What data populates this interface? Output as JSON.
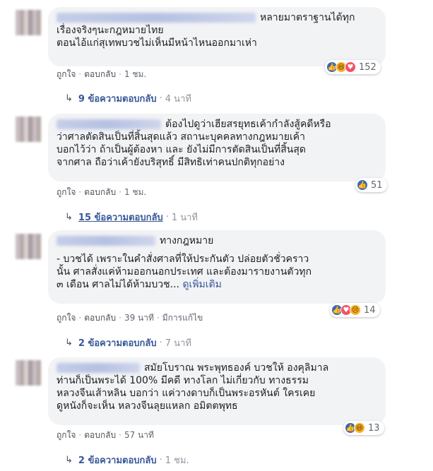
{
  "comments": [
    {
      "lines": [
        "หลายมาตราฐานได้ทุก",
        "เรื่องจริงๆนะกฎหมายไทย",
        "ตอนไอ้แก่สุเทพบวชไม่เห็นมีหน้าไหนออกมาเห่า"
      ],
      "like_label": "ถูกใจ",
      "reply_label": "ตอบกลับ",
      "time": "1 ชม.",
      "reaction_count": "152",
      "replies_text": "9 ข้อความตอบกลับ",
      "replies_time": "4 นาที"
    },
    {
      "lines": [
        "ต้องไปดูว่าเฮียสรยุทธเค้ากำลังสู้คดีหรือ",
        "ว่าศาลตัดสินเป็นที่สิ้นสุดแล้ว สถานะบุคคลทางกฎหมายเค้า",
        "บอกไว้ว่า ถ้าเป็นผู้ต้องหา และ ยังไม่มีการตัดสินเป็นที่สิ้นสุด",
        "จากศาล ถือว่าเค้ายังบริสุทธิ์ มีสิทธิเท่าคนปกติทุกอย่าง"
      ],
      "like_label": "ถูกใจ",
      "reply_label": "ตอบกลับ",
      "time": "1 ชม.",
      "reaction_count": "51",
      "replies_text": "15 ข้อความตอบกลับ",
      "replies_time": "1 นาที"
    },
    {
      "lines": [
        "ทางกฎหมาย",
        "",
        "- บวชได้ เพราะในคำสั่งศาลที่ให้ประกันตัว ปล่อยตัวชั่วคราว",
        "นั้น ศาลสั่งแค่ห้ามออกนอกประเทศ และต้องมารายงานตัวทุก",
        "๓ เดือน ศาลไม่ได้ห้ามบวช..."
      ],
      "see_more": "ดูเพิ่มเติม",
      "like_label": "ถูกใจ",
      "reply_label": "ตอบกลับ",
      "time": "39 นาที",
      "edited": "มีการแก้ไข",
      "reaction_count": "14",
      "replies_text": "2 ข้อความตอบกลับ",
      "replies_time": "7 นาที"
    },
    {
      "lines": [
        "สมัยโบราณ พระพุทธองค์ บวชให้ องคุลิมาล",
        "ท่านก็เป็นพระได้ 100% มีคดี ทางโลก ไม่เกี่ยวกับ ทางธรรม",
        "หลวงจีนเส้าหลิน บอกว่า แค่วางดาบก็เป็นพระอรหันต์ ใครเคย",
        "ดูหนังก็จะเห็น หลวงจีนลุยแหลก อมิตตพุทธ"
      ],
      "like_label": "ถูกใจ",
      "reply_label": "ตอบกลับ",
      "time": "57 นาที",
      "reaction_count": "13",
      "replies_text": "2 ข้อความตอบกลับ",
      "replies_time": "1 ชม."
    }
  ],
  "colors": {
    "like": "#4267b2",
    "love": "#f25268",
    "haha": "#f7b125",
    "link": "#385898",
    "bubble": "#f2f3f5"
  }
}
